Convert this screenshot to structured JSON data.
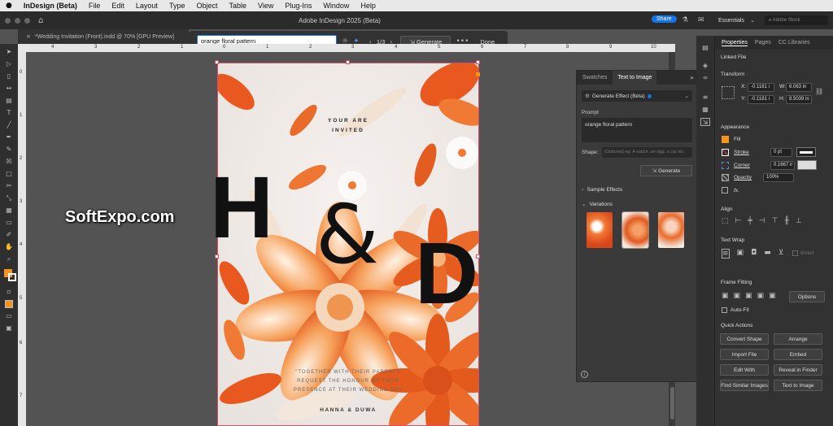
{
  "menubar": {
    "app": "InDesign (Beta)",
    "items": [
      "File",
      "Edit",
      "Layout",
      "Type",
      "Object",
      "Table",
      "View",
      "Plug-Ins",
      "Window",
      "Help"
    ]
  },
  "appbar": {
    "title": "Adobe InDesign 2025 (Beta)",
    "share": "Share",
    "workspace": "Essentials",
    "search_placeholder": "Adobe Stock"
  },
  "doc_tab": {
    "label": "*Wedding Invitation (Front).indd @ 70% [GPU Preview]"
  },
  "genbar": {
    "prompt": "orange floral pattern",
    "counter": "1/3",
    "generate": "Generate",
    "done": "Done"
  },
  "ruler": {
    "top": [
      "4",
      "3",
      "2",
      "1",
      "0",
      "1",
      "2",
      "3",
      "4",
      "5",
      "6",
      "7",
      "8",
      "9",
      "10"
    ],
    "left": [
      "0",
      "1",
      "2",
      "3",
      "4",
      "5",
      "6",
      "7"
    ]
  },
  "invitation": {
    "line1": "YOUR ARE",
    "line2": "INVITED",
    "initial1": "H",
    "ampersand": "&",
    "initial2": "D",
    "body1": "\"TOGETHER WITH THEIR PARENTS",
    "body2": "REQUEST THE HONOUR OF YOUR",
    "body3": "PRESENCE AT THEIR WEDDING DAY",
    "names": "HANNA & DUWA"
  },
  "watermark": "SoftExpo.com",
  "t2i": {
    "tab1": "Swatches",
    "tab2": "Text to Image",
    "effect": "Generate Effect (Beta)",
    "prompt_label": "Prompt",
    "prompt": "orange floral pattern",
    "shape_label": "Shape:",
    "shape_placeholder": "(Optional) eg. A watch, an egg, a car etc.",
    "generate": "Generate",
    "sample": "Sample Effects",
    "variations": "Variations"
  },
  "props": {
    "tabs": [
      "Properties",
      "Pages",
      "CC Libraries"
    ],
    "linked": "Linked File",
    "transform": "Transform",
    "x_label": "X:",
    "x": "-0.1181 i",
    "y_label": "Y:",
    "y": "-0.1181 i",
    "w_label": "W:",
    "w": "6.063 in",
    "h_label": "H:",
    "h": "8.5039 in",
    "appearance": "Appearance",
    "fill": "Fill",
    "stroke": "Stroke",
    "stroke_val": "0 pt",
    "corner": "Corner",
    "corner_val": "0.1667 ir",
    "opacity": "Opacity",
    "opacity_val": "100%",
    "fx": "fx.",
    "align": "Align",
    "textwrap": "Text Wrap",
    "invert": "Invert",
    "framefit": "Frame Fitting",
    "options": "Options",
    "autofit": "Auto-Fit",
    "quick": "Quick Actions",
    "qa": [
      "Convert Shape",
      "Arrange",
      "Import File",
      "Embed",
      "Edit With",
      "Reveal in Finder",
      "Find Similar Images",
      "Text to Image"
    ]
  },
  "colors": {
    "accent": "#1473e6",
    "orange": "#f7941d"
  }
}
